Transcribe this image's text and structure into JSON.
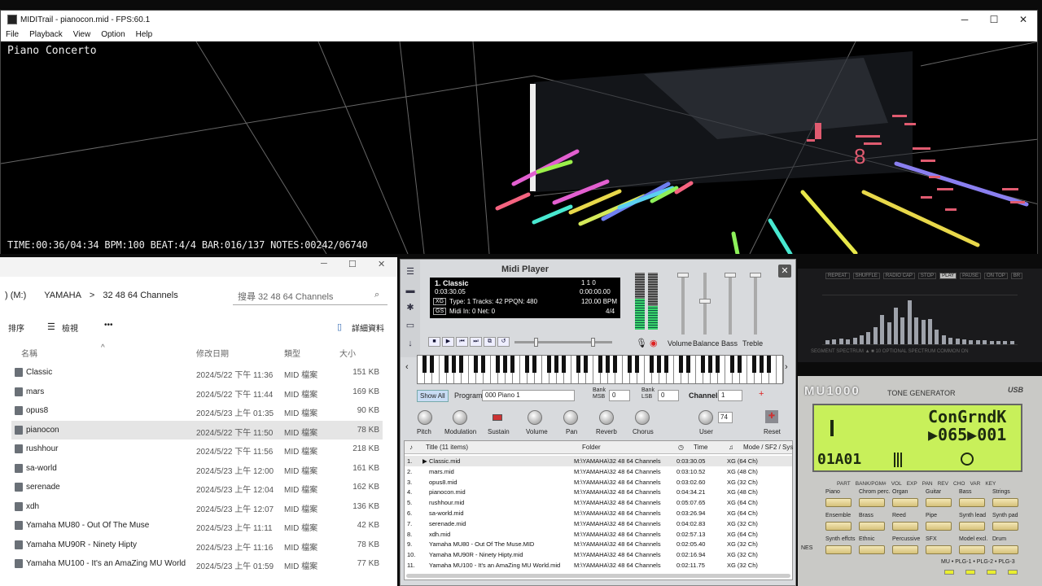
{
  "trail": {
    "window_title": "MIDITrail - pianocon.mid - FPS:60.1",
    "menu": [
      "File",
      "Playback",
      "View",
      "Option",
      "Help"
    ],
    "song_title": "Piano Concerto",
    "status": "TIME:00:36/04:34 BPM:100 BEAT:4/4 BAR:016/137 NOTES:00242/06740",
    "controls": {
      "minimize": "─",
      "maximize": "☐",
      "close": "✕"
    }
  },
  "explorer": {
    "breadcrumb": [
      ") (M:)",
      "YAMAHA",
      ">",
      "32 48 64 Channels"
    ],
    "search_placeholder": "搜尋 32 48 64 Channels",
    "commands": {
      "sort": "排序",
      "view": "檢視",
      "more": "•••",
      "details": "詳細資料"
    },
    "columns": {
      "name": "名稱",
      "date": "修改日期",
      "type": "類型",
      "size": "大小"
    },
    "files": [
      {
        "name": "Classic",
        "date": "2024/5/22 下午 11:36",
        "type": "MID 檔案",
        "size": "151 KB"
      },
      {
        "name": "mars",
        "date": "2024/5/22 下午 11:44",
        "type": "MID 檔案",
        "size": "169 KB"
      },
      {
        "name": "opus8",
        "date": "2024/5/23 上午 01:35",
        "type": "MID 檔案",
        "size": "90 KB"
      },
      {
        "name": "pianocon",
        "date": "2024/5/22 下午 11:50",
        "type": "MID 檔案",
        "size": "78 KB"
      },
      {
        "name": "rushhour",
        "date": "2024/5/22 下午 11:56",
        "type": "MID 檔案",
        "size": "218 KB"
      },
      {
        "name": "sa-world",
        "date": "2024/5/23 上午 12:00",
        "type": "MID 檔案",
        "size": "161 KB"
      },
      {
        "name": "serenade",
        "date": "2024/5/23 上午 12:04",
        "type": "MID 檔案",
        "size": "162 KB"
      },
      {
        "name": "xdh",
        "date": "2024/5/23 上午 12:07",
        "type": "MID 檔案",
        "size": "136 KB"
      },
      {
        "name": "Yamaha MU80 - Out Of The Muse",
        "date": "2024/5/23 上午 11:11",
        "type": "MID 檔案",
        "size": "42 KB"
      },
      {
        "name": "Yamaha MU90R - Ninety Hipty",
        "date": "2024/5/23 上午 11:16",
        "type": "MID 檔案",
        "size": "78 KB"
      },
      {
        "name": "Yamaha MU100 - It's an AmaZing MU World",
        "date": "2024/5/23 上午 01:59",
        "type": "MID 檔案",
        "size": "77 KB"
      }
    ]
  },
  "player": {
    "heading": "Midi Player",
    "lcd": {
      "title": "1.   Classic",
      "counter": "1      1      0",
      "elapsed": "0:03:30.05",
      "pos": "0:00:00.00",
      "tag1": "XG",
      "info1": "Type: 1  Tracks: 42  PPQN: 480",
      "bpm": "120.00 BPM",
      "tag2": "GS",
      "info2": "Midi In: 0   Net: 0",
      "beat": "4/4"
    },
    "mixer_labels": [
      "Volume",
      "Balance",
      "Bass",
      "Treble"
    ],
    "meters": [
      0.55,
      0.42
    ],
    "show_all": "Show All",
    "program_label": "Program",
    "program_value": "000 Piano 1",
    "bank_msb_label": "Bank MSB",
    "bank_msb": "0",
    "bank_lsb_label": "Bank LSB",
    "bank_lsb": "0",
    "channel_label": "Channel",
    "channel_value": "1",
    "knob_labels": [
      "Pitch",
      "Modulation",
      "Sustain",
      "Volume",
      "Pan",
      "Reverb",
      "Chorus",
      "User",
      "Reset"
    ],
    "user_value": "74",
    "playlist_header": {
      "title": "Title  (11 items)",
      "folder": "Folder",
      "time": "Time",
      "mode": "Mode / SF2 / Sys"
    },
    "playlist": [
      {
        "n": "1.",
        "title": "Classic.mid",
        "folder": "M:\\YAMAHA\\32 48 64 Channels",
        "time": "0:03:30.05",
        "mode": "XG (64 Ch)"
      },
      {
        "n": "2.",
        "title": "mars.mid",
        "folder": "M:\\YAMAHA\\32 48 64 Channels",
        "time": "0:03:10.52",
        "mode": "XG (48 Ch)"
      },
      {
        "n": "3.",
        "title": "opus8.mid",
        "folder": "M:\\YAMAHA\\32 48 64 Channels",
        "time": "0:03:02.60",
        "mode": "XG (32 Ch)"
      },
      {
        "n": "4.",
        "title": "pianocon.mid",
        "folder": "M:\\YAMAHA\\32 48 64 Channels",
        "time": "0:04:34.21",
        "mode": "XG (48 Ch)"
      },
      {
        "n": "5.",
        "title": "rushhour.mid",
        "folder": "M:\\YAMAHA\\32 48 64 Channels",
        "time": "0:05:07.65",
        "mode": "XG (64 Ch)"
      },
      {
        "n": "6.",
        "title": "sa-world.mid",
        "folder": "M:\\YAMAHA\\32 48 64 Channels",
        "time": "0:03:26.94",
        "mode": "XG (64 Ch)"
      },
      {
        "n": "7.",
        "title": "serenade.mid",
        "folder": "M:\\YAMAHA\\32 48 64 Channels",
        "time": "0:04:02.83",
        "mode": "XG (32 Ch)"
      },
      {
        "n": "8.",
        "title": "xdh.mid",
        "folder": "M:\\YAMAHA\\32 48 64 Channels",
        "time": "0:02:57.13",
        "mode": "XG (64 Ch)"
      },
      {
        "n": "9.",
        "title": "Yamaha MU80 - Out Of The Muse.MID",
        "folder": "M:\\YAMAHA\\32 48 64 Channels",
        "time": "0:02:05.40",
        "mode": "XG (32 Ch)"
      },
      {
        "n": "10.",
        "title": "Yamaha MU90R - Ninety Hipty.mid",
        "folder": "M:\\YAMAHA\\32 48 64 Channels",
        "time": "0:02:16.94",
        "mode": "XG (32 Ch)"
      },
      {
        "n": "11.",
        "title": "Yamaha MU100 - It's an AmaZing MU World.mid",
        "folder": "M:\\YAMAHA\\32 48 64 Channels",
        "time": "0:02:11.75",
        "mode": "XG (32 Ch)"
      }
    ]
  },
  "spectrum": {
    "buttons": [
      "REPEAT",
      "SHUFFLE",
      "RADIO CAP",
      "STOP",
      "PLAY",
      "PAUSE",
      "ON TOP",
      "BR"
    ],
    "active_button": "PLAY",
    "footer": "SEGMENT    SPECTRUM ▲ ■    10 OPTIONAL SPECTRUM    COMMON ON",
    "levels": [
      0.08,
      0.1,
      0.12,
      0.1,
      0.14,
      0.18,
      0.25,
      0.35,
      0.6,
      0.45,
      0.75,
      0.55,
      0.9,
      0.55,
      0.5,
      0.52,
      0.3,
      0.18,
      0.14,
      0.12,
      0.1,
      0.09,
      0.08,
      0.08,
      0.07,
      0.07,
      0.06,
      0.06
    ]
  },
  "mu1000": {
    "logo": "MU1000",
    "subtitle": "TONE GENERATOR",
    "usb": "USB",
    "lcd_line1": "ConGrndK",
    "lcd_line2": "▶065▶001",
    "lcd_line3": "01A01",
    "params": [
      "PART",
      "BANK/PGM#",
      "VOL",
      "EXP",
      "PAN",
      "REV",
      "CHO",
      "VAR",
      "KEY"
    ],
    "buttons": [
      [
        "Piano",
        "Chrom perc.",
        "Organ",
        "Guitar",
        "Bass",
        "Strings"
      ],
      [
        "Ensemble",
        "Brass",
        "Reed",
        "Pipe",
        "Synth lead",
        "Synth pad"
      ],
      [
        "Synth effcts",
        "Ethnic",
        "Percussive",
        "SFX",
        "Model excl.",
        "Drum"
      ]
    ],
    "plg": "MU • PLG-1 • PLG-2 • PLG-3",
    "side": "NES"
  }
}
